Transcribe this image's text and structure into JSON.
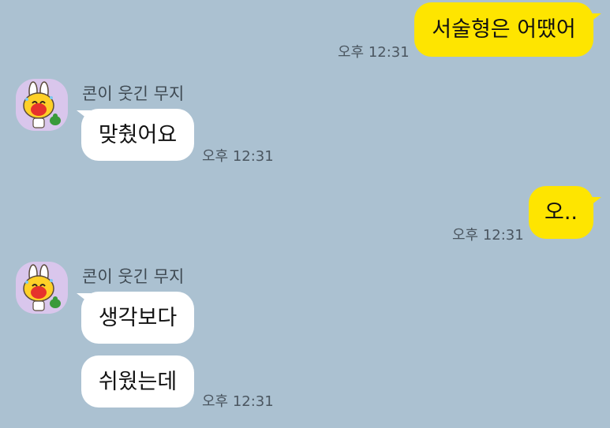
{
  "colors": {
    "background": "#abc1d1",
    "my_bubble": "#fee500",
    "their_bubble": "#ffffff",
    "avatar_bg": "#d9c6ec"
  },
  "messages": [
    {
      "text": "서술형은 어땠어",
      "time": "오후 12:31"
    },
    {
      "sender": "콘이 웃긴 무지",
      "text": "맞췄어요",
      "time": "오후 12:31"
    },
    {
      "text": "오..",
      "time": "오후 12:31"
    },
    {
      "sender": "콘이 웃긴 무지",
      "text": "생각보다"
    },
    {
      "text": "쉬웠는데",
      "time": "오후 12:31"
    }
  ],
  "avatar_icon": "muzi-laughing-avatar-icon"
}
